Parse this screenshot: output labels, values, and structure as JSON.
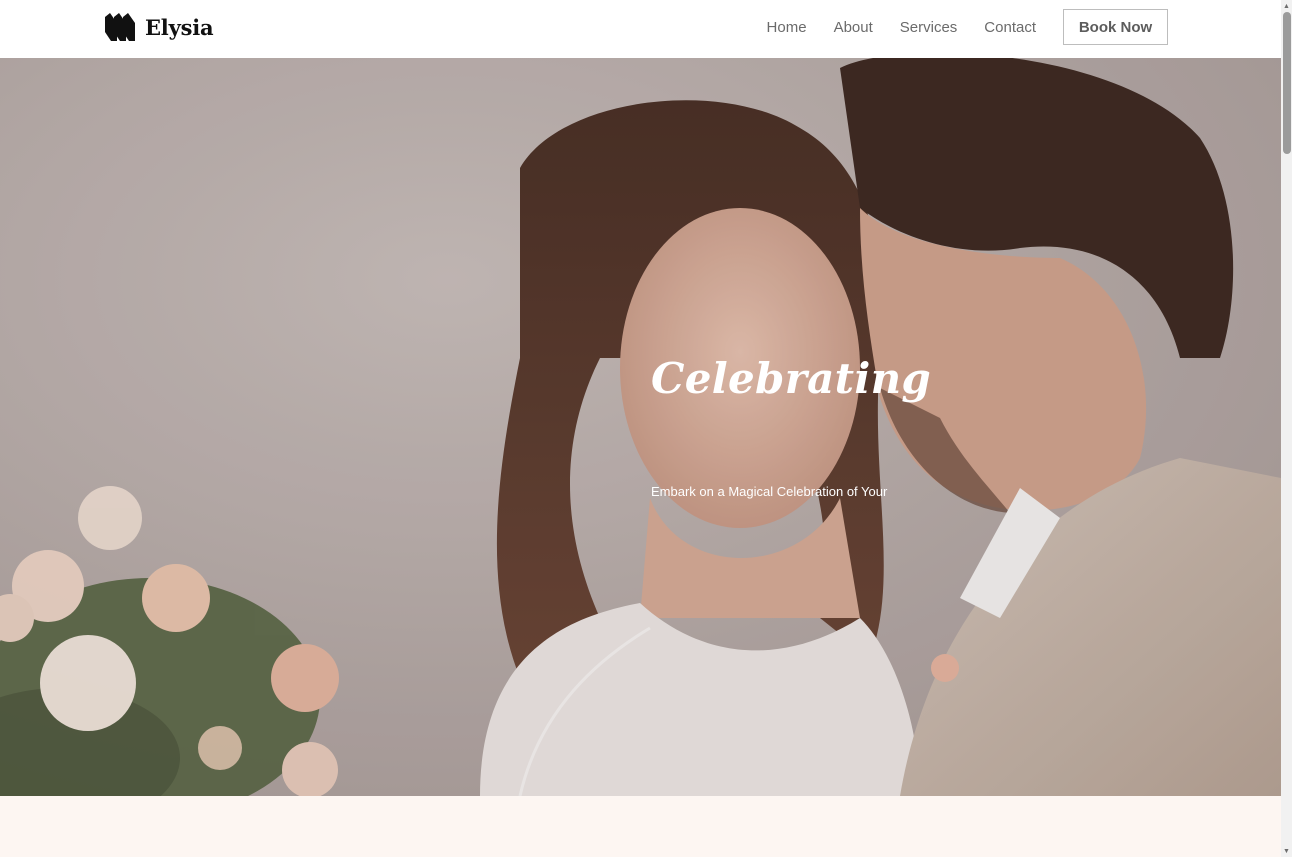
{
  "brand": {
    "name": "Elysia",
    "logo_icon": "triple-chevron-logo-icon"
  },
  "nav": {
    "items": [
      {
        "label": "Home"
      },
      {
        "label": "About"
      },
      {
        "label": "Services"
      },
      {
        "label": "Contact"
      }
    ],
    "cta_label": "Book Now"
  },
  "hero": {
    "title": "Celebrating",
    "subtitle": "Embark on a Magical Celebration of Your",
    "image": "wedding-couple-photo"
  },
  "colors": {
    "header_bg": "#ffffff",
    "nav_text": "#6b6b6b",
    "button_border": "#bdbdbd",
    "hero_text": "#ffffff",
    "next_section_bg": "#fdf6f2"
  }
}
